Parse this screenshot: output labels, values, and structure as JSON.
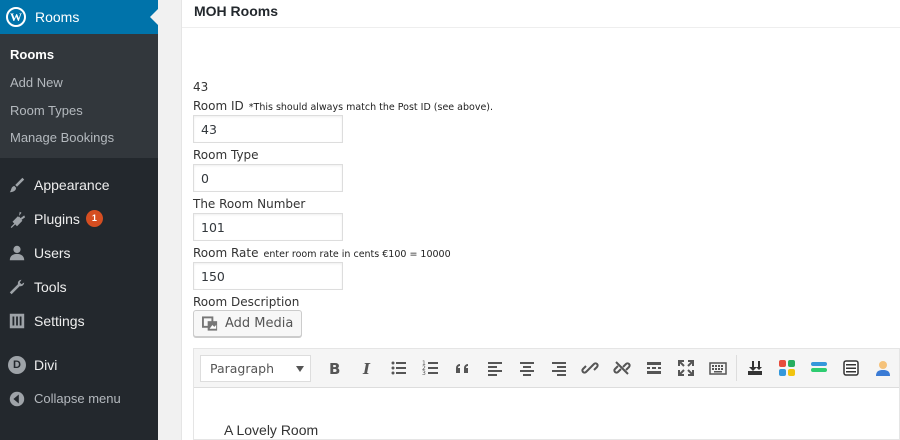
{
  "sidebar": {
    "active_menu": "Rooms",
    "submenu": [
      "Rooms",
      "Add New",
      "Room Types",
      "Manage Bookings"
    ],
    "items": [
      {
        "label": "Appearance"
      },
      {
        "label": "Plugins",
        "badge": "1"
      },
      {
        "label": "Users"
      },
      {
        "label": "Tools"
      },
      {
        "label": "Settings"
      }
    ],
    "divi": "Divi",
    "divi_letter": "D",
    "collapse": "Collapse menu"
  },
  "panel": {
    "title": "MOH Rooms",
    "post_id": "43"
  },
  "fields": {
    "room_id": {
      "label": "Room ID",
      "note": "*This should always match the Post ID (see above).",
      "value": "43"
    },
    "room_type": {
      "label": "Room Type",
      "value": "0"
    },
    "room_number": {
      "label": "The Room Number",
      "value": "101"
    },
    "room_rate": {
      "label": "Room Rate",
      "note": "enter room rate in cents €100 = 10000",
      "value": "150"
    },
    "room_description": {
      "label": "Room Description"
    }
  },
  "editor": {
    "add_media": "Add Media",
    "format": "Paragraph",
    "body_text": "A Lovely Room",
    "toolbar_icons": [
      "bold-icon",
      "italic-icon",
      "bullet-list-icon",
      "numbered-list-icon",
      "blockquote-icon",
      "align-left-icon",
      "align-center-icon",
      "align-right-icon",
      "link-icon",
      "unlink-icon",
      "read-more-icon",
      "fullscreen-icon",
      "keyboard-icon",
      "download-icon",
      "colors-icon",
      "stack-icon",
      "list-icon",
      "user-icon"
    ]
  },
  "colors": {
    "sidebar_bg": "#23282d",
    "active_blue": "#0073aa",
    "badge": "#d54e21"
  }
}
